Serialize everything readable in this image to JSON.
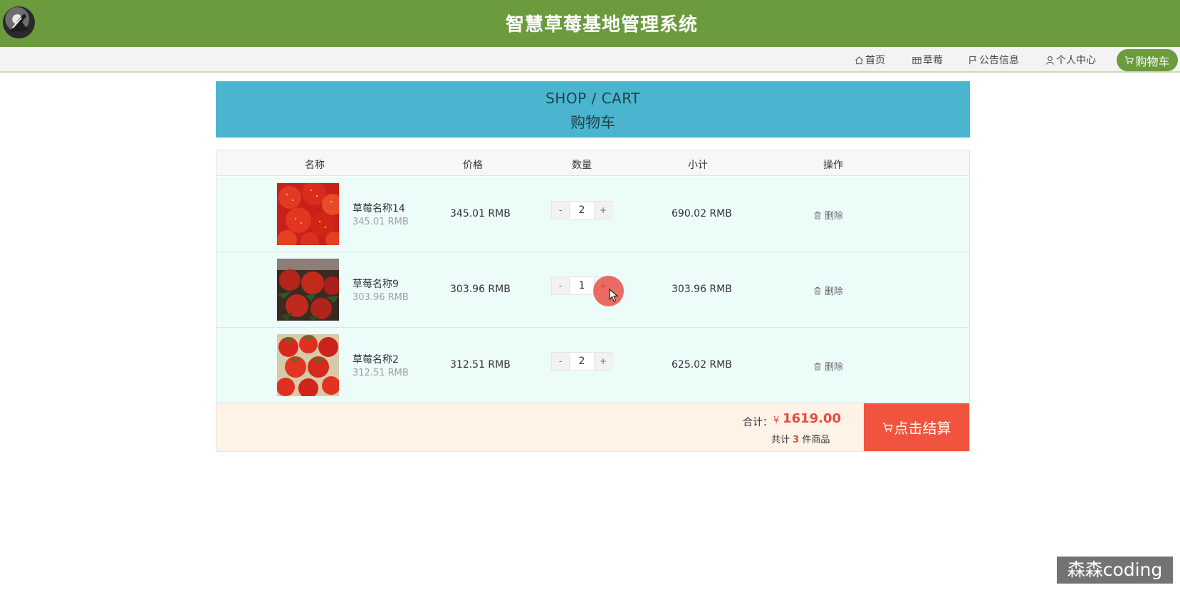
{
  "header": {
    "title": "智慧草莓基地管理系统"
  },
  "nav": {
    "items": [
      {
        "label": "首页",
        "icon": "home-icon"
      },
      {
        "label": "草莓",
        "icon": "grid-icon"
      },
      {
        "label": "公告信息",
        "icon": "flag-icon"
      },
      {
        "label": "个人中心",
        "icon": "user-icon"
      }
    ],
    "cart_label": "购物车",
    "accent_color": "#6b9b3d"
  },
  "banner": {
    "title_en": "SHOP / CART",
    "title_cn": "购物车",
    "color": "#4bb5cf"
  },
  "table": {
    "headers": [
      "名称",
      "价格",
      "数量",
      "小计",
      "操作"
    ],
    "rows": [
      {
        "name": "草莓名称14",
        "unit_price": "345.01 RMB",
        "price": "345.01 RMB",
        "qty": "2",
        "subtotal": "690.02 RMB",
        "action": "删除"
      },
      {
        "name": "草莓名称9",
        "unit_price": "303.96 RMB",
        "price": "303.96 RMB",
        "qty": "1",
        "subtotal": "303.96 RMB",
        "action": "删除"
      },
      {
        "name": "草莓名称2",
        "unit_price": "312.51 RMB",
        "price": "312.51 RMB",
        "qty": "2",
        "subtotal": "625.02 RMB",
        "action": "删除"
      }
    ],
    "minus_label": "-",
    "plus_label": "+"
  },
  "summary": {
    "total_label": "合计：",
    "currency": "¥",
    "total": "1619.00",
    "count_prefix": "共计",
    "count": "3",
    "count_suffix": "件商品",
    "checkout_label": "点击结算",
    "checkout_color": "#f0543e"
  },
  "watermark": "森森coding"
}
